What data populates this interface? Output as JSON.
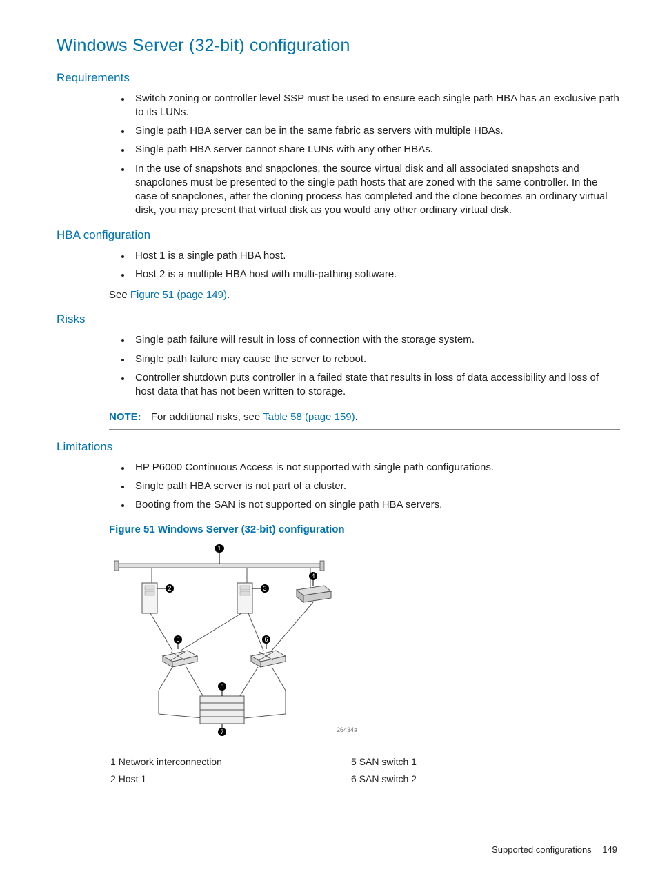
{
  "title": "Windows Server (32-bit) configuration",
  "sections": {
    "requirements": {
      "heading": "Requirements",
      "items": [
        "Switch zoning or controller level SSP must be used to ensure each single path HBA has an exclusive path to its LUNs.",
        "Single path HBA server can be in the same fabric as servers with multiple HBAs.",
        "Single path HBA server cannot share LUNs with any other HBAs.",
        "In the use of snapshots and snapclones, the source virtual disk and all associated snapshots and snapclones must be presented to the single path hosts that are zoned with the same controller. In the case of snapclones, after the cloning process has completed and the clone becomes an ordinary virtual disk, you may present that virtual disk as you would any other ordinary virtual disk."
      ]
    },
    "hba": {
      "heading": "HBA configuration",
      "items": [
        "Host 1 is a single path HBA host.",
        "Host 2 is a multiple HBA host with multi-pathing software."
      ],
      "see_prefix": "See ",
      "see_link": "Figure 51 (page 149)",
      "see_suffix": "."
    },
    "risks": {
      "heading": "Risks",
      "items": [
        "Single path failure will result in loss of connection with the storage system.",
        "Single path failure may cause the server to reboot.",
        "Controller shutdown puts controller in a failed state that results in loss of data accessibility and loss of host data that has not been written to storage."
      ],
      "note_label": "NOTE:",
      "note_prefix": "For additional risks, see ",
      "note_link": "Table 58 (page 159)",
      "note_suffix": "."
    },
    "limitations": {
      "heading": "Limitations",
      "items": [
        "HP P6000 Continuous Access is not supported with single path configurations.",
        "Single path HBA server is not part of a cluster.",
        "Booting from the SAN is not supported on single path HBA servers."
      ]
    }
  },
  "figure": {
    "caption": "Figure 51 Windows Server (32-bit) configuration",
    "diagram_id": "26434a",
    "callouts": [
      "1",
      "2",
      "3",
      "4",
      "5",
      "6",
      "7",
      "8"
    ],
    "legend": [
      {
        "num": "1",
        "label": "Network interconnection"
      },
      {
        "num": "2",
        "label": "Host 1"
      },
      {
        "num": "5",
        "label": "SAN switch 1"
      },
      {
        "num": "6",
        "label": "SAN switch 2"
      }
    ]
  },
  "footer": {
    "section": "Supported configurations",
    "page": "149"
  }
}
